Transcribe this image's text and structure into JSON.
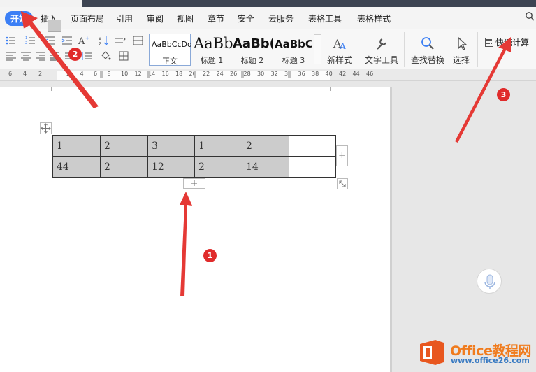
{
  "menu": {
    "items": [
      "开始",
      "插入",
      "页面布局",
      "引用",
      "审阅",
      "视图",
      "章节",
      "安全",
      "云服务",
      "表格工具",
      "表格样式"
    ],
    "active_index": 0
  },
  "ribbon": {
    "styles": [
      {
        "preview": "AaBbCcDd",
        "caption": "正文"
      },
      {
        "preview": "AaBb",
        "caption": "标题 1"
      },
      {
        "preview": "AaBb(",
        "caption": "标题 2"
      },
      {
        "preview": "AaBbC",
        "caption": "标题 3"
      }
    ],
    "new_style": "新样式",
    "text_tools": "文字工具",
    "find_replace": "查找替换",
    "select": "选择",
    "quick_calc": "快速计算",
    "font_size_glyph": "A",
    "font_size_glyph_sup": "+"
  },
  "ruler": {
    "left_numbers": [
      "6",
      "4",
      "2"
    ],
    "numbers": [
      "2",
      "4",
      "6",
      "8",
      "10",
      "12",
      "14",
      "16",
      "18",
      "20",
      "22",
      "24",
      "26",
      "28",
      "30",
      "32",
      "34",
      "36",
      "38",
      "40",
      "42",
      "44",
      "46"
    ]
  },
  "table": {
    "rows": [
      [
        "1",
        "2",
        "3",
        "1",
        "2",
        ""
      ],
      [
        "44",
        "2",
        "12",
        "2",
        "14",
        ""
      ]
    ]
  },
  "table_controls": {
    "add_symbol": "+"
  },
  "annotations": {
    "badges": [
      "1",
      "2",
      "3"
    ]
  },
  "watermark": {
    "brand": "Office教程网",
    "url": "www.office26.com"
  },
  "colors": {
    "accent": "#3b7ff5",
    "arrow": "#e53935",
    "cell_fill": "#cccccc",
    "brand_orange": "#f07b1d"
  }
}
